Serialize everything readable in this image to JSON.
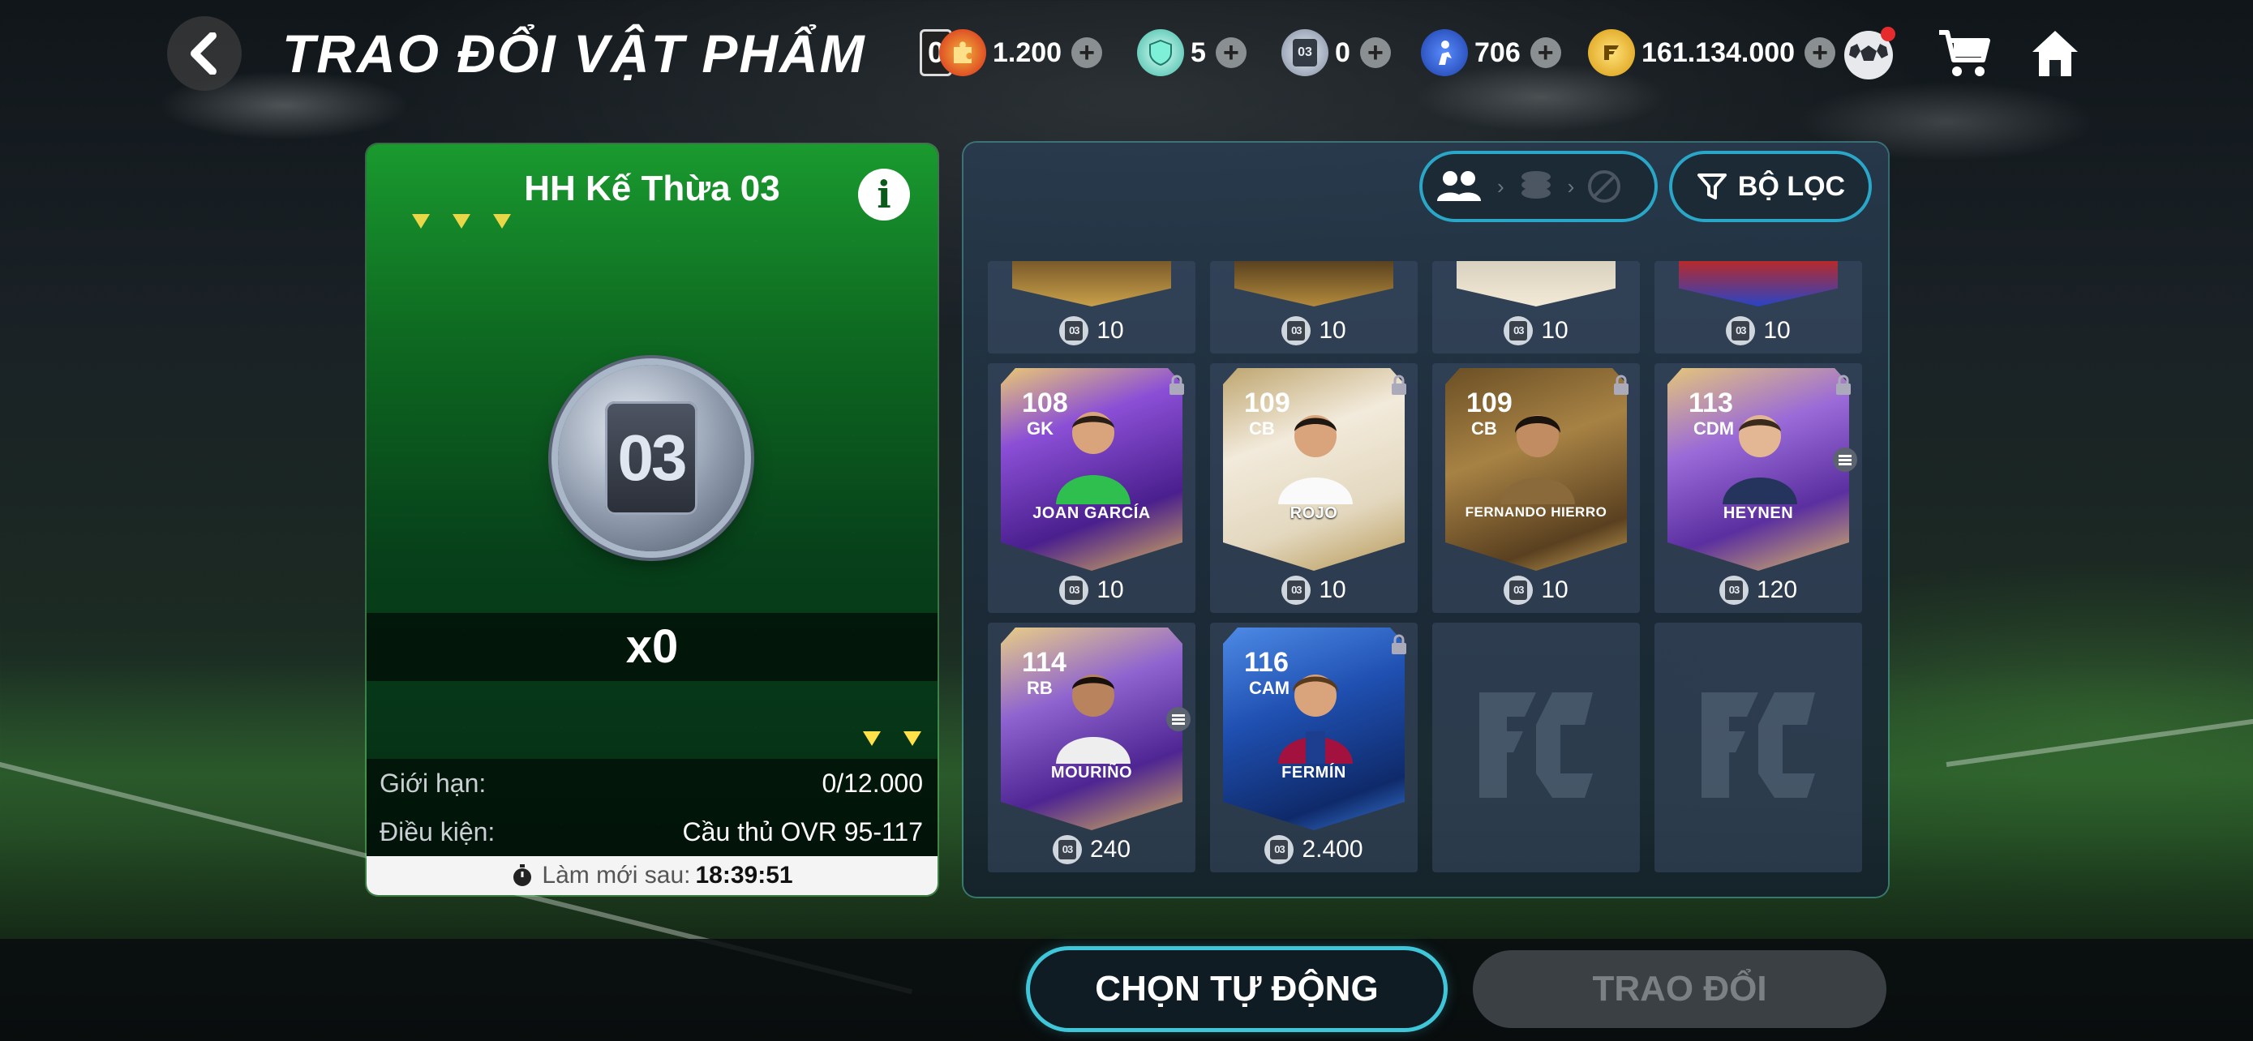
{
  "header": {
    "title": "TRAO ĐỔI VẬT PHẨM",
    "currencies": [
      {
        "icon": "puzzle-badge-icon",
        "prefix": "0",
        "value": "1.200"
      },
      {
        "icon": "shield-gem-icon",
        "value": "5"
      },
      {
        "icon": "token-03-icon",
        "value": "0"
      },
      {
        "icon": "player-coin-icon",
        "value": "706"
      },
      {
        "icon": "fc-coin-icon",
        "value": "161.134.000"
      }
    ]
  },
  "item": {
    "title": "HH Kế Thừa 03",
    "token_label": "03",
    "count": "x0",
    "limit_label": "Giới hạn:",
    "limit_value": "0/12.000",
    "condition_label": "Điều kiện:",
    "condition_value": "Cầu thủ OVR 95-117",
    "refresh_label": "Làm mới sau:",
    "refresh_time": "18:39:51"
  },
  "filter": {
    "label": "BỘ LỌC"
  },
  "cards": {
    "top_partial_prices": [
      "10",
      "10",
      "10",
      "10"
    ],
    "players": [
      {
        "ovr": "108",
        "pos": "GK",
        "name": "JOAN GARCÍA",
        "price": "10",
        "theme": "purple",
        "locked": true
      },
      {
        "ovr": "109",
        "pos": "CB",
        "name": "ROJO",
        "price": "10",
        "theme": "gold-light",
        "locked": true
      },
      {
        "ovr": "109",
        "pos": "CB",
        "name": "FERNANDO HIERRO",
        "price": "10",
        "theme": "bronze",
        "locked": true
      },
      {
        "ovr": "113",
        "pos": "CDM",
        "name": "HEYNEN",
        "price": "120",
        "theme": "purple-gold",
        "locked": true
      },
      {
        "ovr": "114",
        "pos": "RB",
        "name": "MOURIÑO",
        "price": "240",
        "theme": "purple-gold",
        "locked": false
      },
      {
        "ovr": "116",
        "pos": "CAM",
        "name": "FERMÍN",
        "price": "2.400",
        "theme": "blue",
        "locked": true
      }
    ]
  },
  "buttons": {
    "auto": "CHỌN TỰ ĐỘNG",
    "trade": "TRAO ĐỔI"
  },
  "colors": {
    "accent": "#3fc7d9",
    "green_panel": "#0e6a21",
    "yellow_marker": "#ffe14a"
  }
}
